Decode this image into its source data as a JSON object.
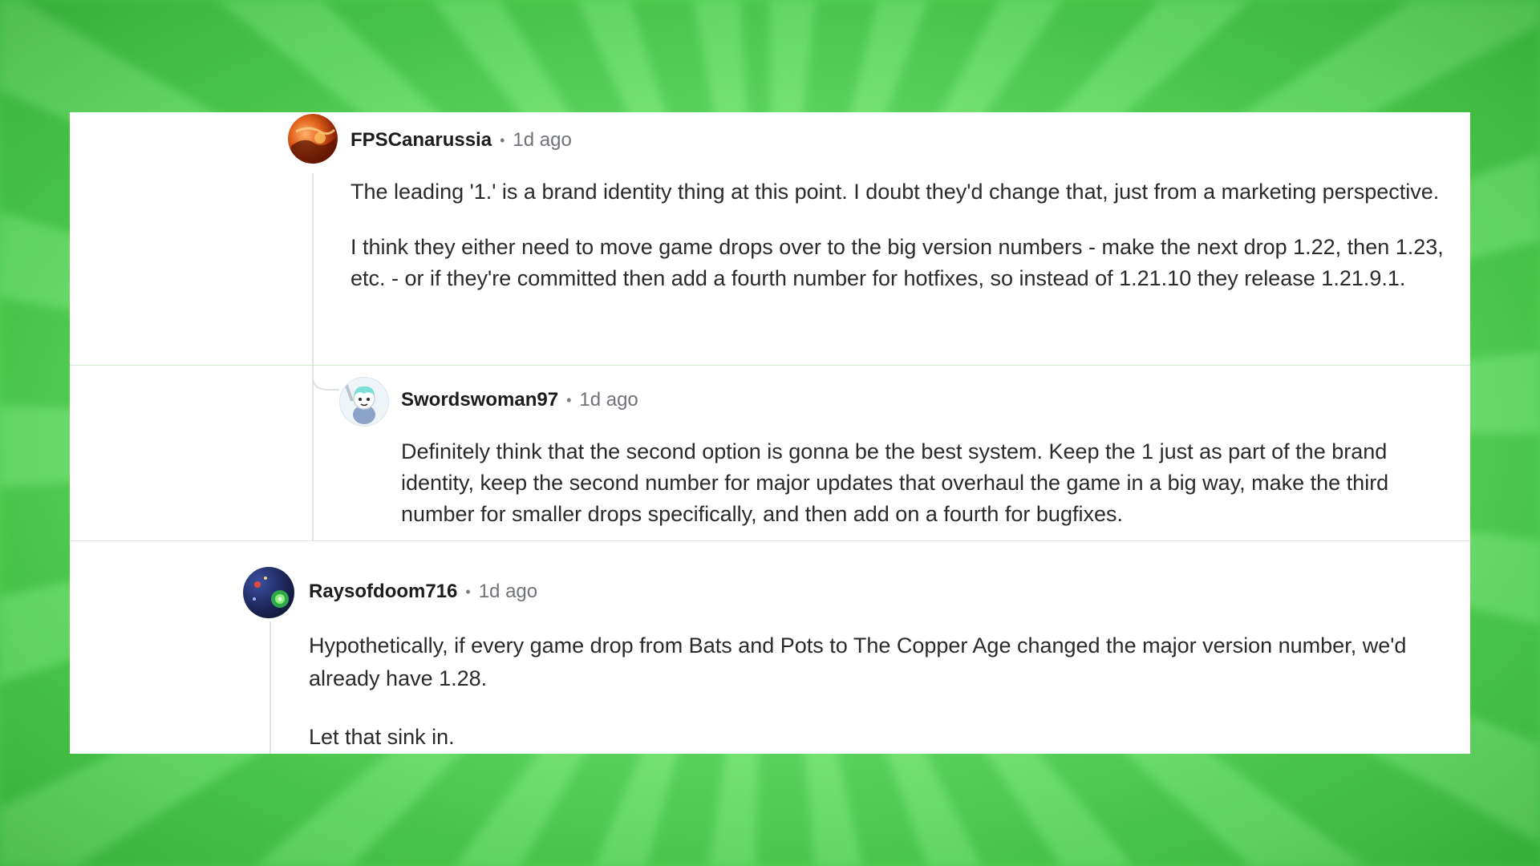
{
  "comments": [
    {
      "username": "FPSCanarussia",
      "time": "1d ago",
      "paragraphs": [
        "The leading '1.' is a brand identity thing at this point. I doubt they'd change that, just from a marketing perspective.",
        "I think they either need to move game drops over to the big version numbers - make the next drop 1.22, then 1.23, etc. - or if they're committed then add a fourth number for hotfixes, so instead of 1.21.10 they release 1.21.9.1."
      ]
    },
    {
      "username": "Swordswoman97",
      "time": "1d ago",
      "paragraphs": [
        "Definitely think that the second option is gonna be the best system. Keep the 1 just as part of the brand identity, keep the second number for major updates that overhaul the game in a big way, make the third number for smaller drops specifically, and then add on a fourth for bugfixes."
      ]
    },
    {
      "username": "Raysofdoom716",
      "time": "1d ago",
      "paragraphs": [
        "Hypothetically, if every game drop from Bats and Pots to The Copper Age changed the major version number, we'd already have 1.28.",
        "Let that sink in."
      ]
    }
  ]
}
